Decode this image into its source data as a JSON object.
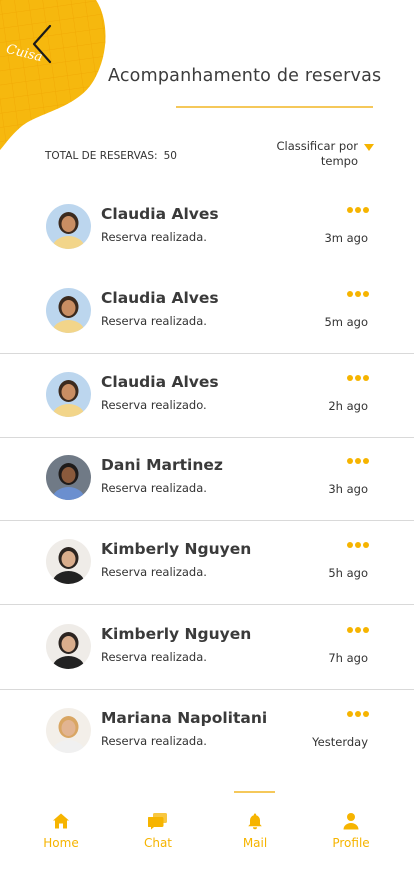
{
  "header": {
    "title": "Acompanhamento de reservas",
    "blob_text": "Cuisa"
  },
  "summary": {
    "total_label": "TOTAL DE RESERVAS:",
    "total_value": "50",
    "sort_label": "Classificar por tempo"
  },
  "reservations": [
    {
      "name": "Claudia Alves",
      "message": "Reserva realizada.",
      "time": "3m ago"
    },
    {
      "name": "Claudia Alves",
      "message": "Reserva realizada.",
      "time": "5m ago"
    },
    {
      "name": "Claudia Alves",
      "message": "Reserva realizado.",
      "time": "2h ago"
    },
    {
      "name": "Dani Martinez",
      "message": "Reserva realizada.",
      "time": "3h ago"
    },
    {
      "name": "Kimberly Nguyen",
      "message": "Reserva realizada.",
      "time": "5h ago"
    },
    {
      "name": "Kimberly Nguyen",
      "message": "Reserva realizada.",
      "time": "7h ago"
    },
    {
      "name": "Mariana Napolitani",
      "message": "Reserva realizada.",
      "time": "Yesterday"
    }
  ],
  "nav": {
    "home": "Home",
    "chat": "Chat",
    "mail": "Mail",
    "profile": "Profile",
    "active": "mail"
  },
  "colors": {
    "accent": "#f6b400",
    "accent_light": "#f5c85a",
    "text": "#3a3a3a",
    "divider": "#d9d9d9"
  }
}
